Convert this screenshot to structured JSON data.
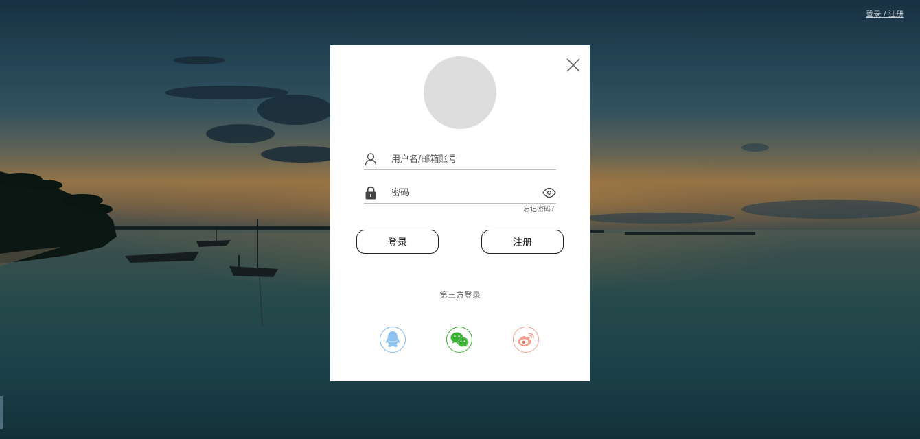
{
  "header": {
    "auth_link": "登录 / 注册"
  },
  "dialog": {
    "username_placeholder": "用户名/邮箱账号",
    "password_placeholder": "密码",
    "forgot_password": "忘记密码？",
    "login_button": "登录",
    "register_button": "注册",
    "third_party_label": "第三方登录",
    "social": [
      {
        "name": "qq",
        "icon": "qq-icon",
        "color": "#7fb8ef"
      },
      {
        "name": "wechat",
        "icon": "wechat-icon",
        "color": "#3cb034"
      },
      {
        "name": "weibo",
        "icon": "weibo-icon",
        "color": "#e8705a"
      }
    ]
  }
}
